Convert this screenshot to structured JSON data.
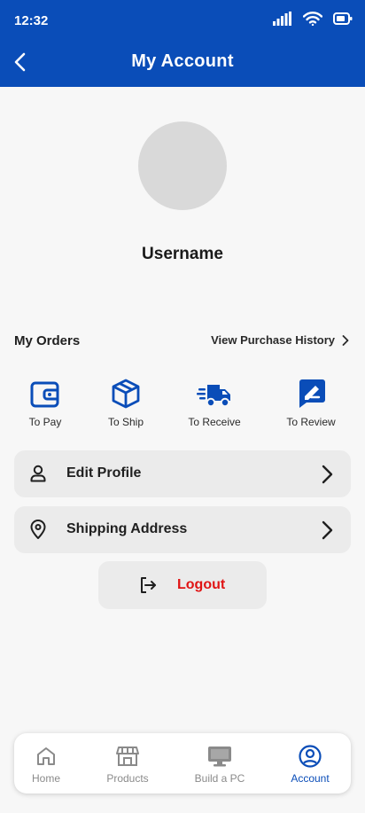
{
  "status_bar": {
    "time": "12:32",
    "icons": [
      "signal-icon",
      "wifi-icon",
      "battery-icon"
    ]
  },
  "header": {
    "title": "My Account",
    "back_icon": "back-arrow-icon",
    "background": "#0a4db8"
  },
  "profile": {
    "username": "Username",
    "avatar_color": "#d9d9d9"
  },
  "orders": {
    "title": "My Orders",
    "history_link": "View Purchase History",
    "items": [
      {
        "label": "To Pay",
        "icon": "wallet-icon"
      },
      {
        "label": "To Ship",
        "icon": "box-icon"
      },
      {
        "label": "To Receive",
        "icon": "truck-icon"
      },
      {
        "label": "To Review",
        "icon": "review-icon"
      }
    ]
  },
  "menu": [
    {
      "label": "Edit Profile",
      "icon": "user-icon"
    },
    {
      "label": "Shipping Address",
      "icon": "location-icon"
    }
  ],
  "logout": {
    "label": "Logout",
    "icon": "logout-icon",
    "color": "#e01414"
  },
  "bottom_nav": {
    "items": [
      {
        "label": "Home",
        "icon": "home-icon",
        "active": false
      },
      {
        "label": "Products",
        "icon": "store-icon",
        "active": false
      },
      {
        "label": "Build a PC",
        "icon": "monitor-icon",
        "active": false
      },
      {
        "label": "Account",
        "icon": "account-icon",
        "active": true
      }
    ],
    "active_color": "#0a4db8",
    "inactive_color": "#8a8a8a"
  }
}
